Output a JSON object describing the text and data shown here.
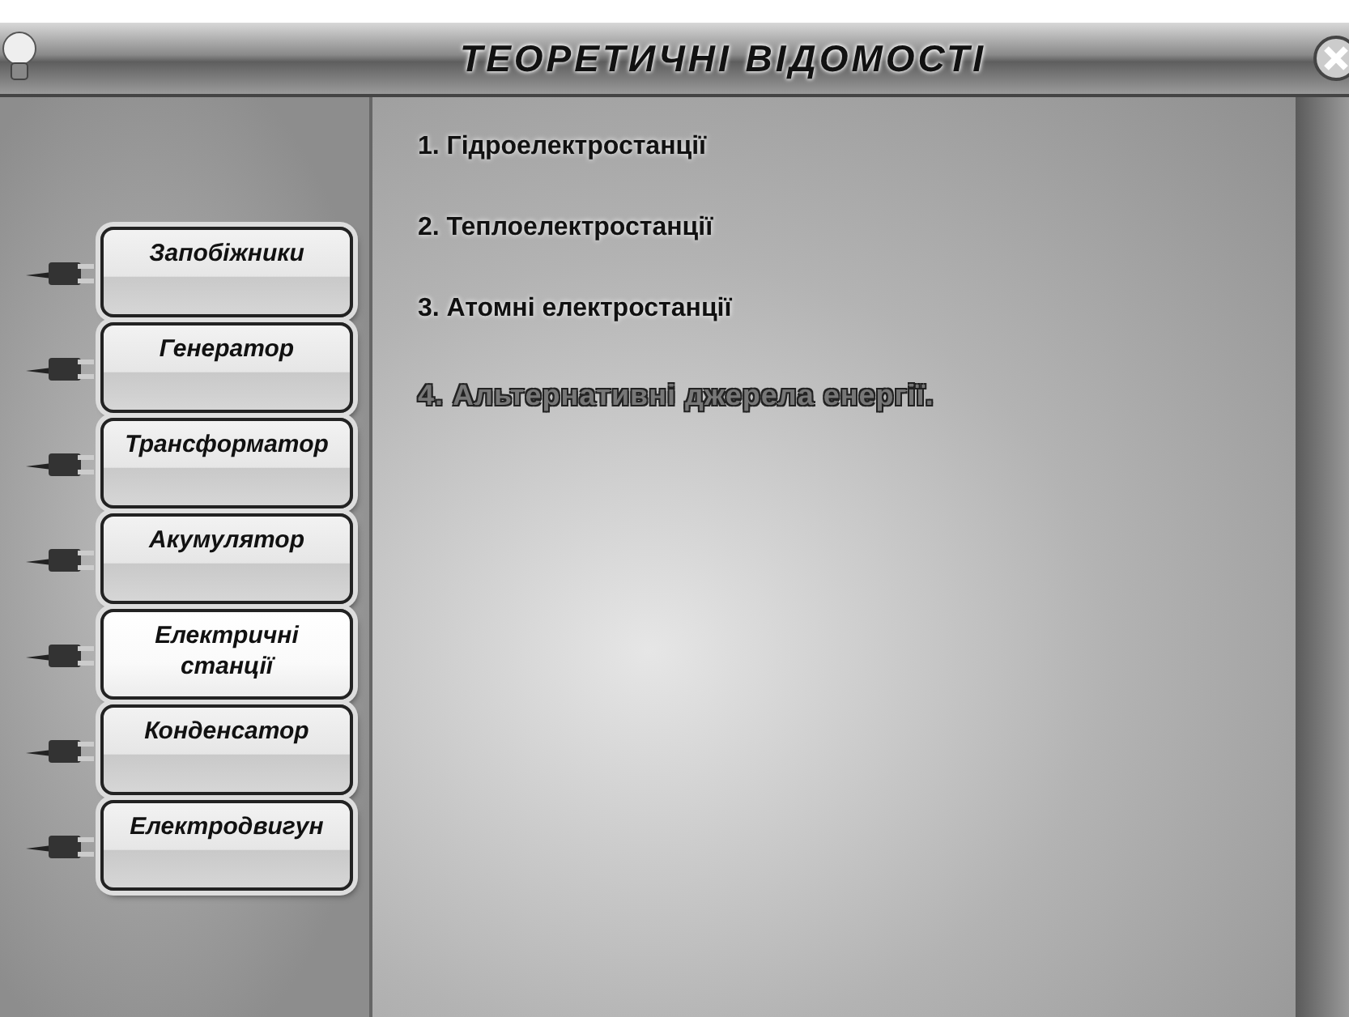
{
  "window": {
    "title": "ТЕОРЕТИЧНІ ВІДОМОСТІ"
  },
  "menu": [
    {
      "label": "Запобіжники",
      "selected": false
    },
    {
      "label": "Генератор",
      "selected": false
    },
    {
      "label": "Трансформатор",
      "selected": false
    },
    {
      "label": "Акумулятор",
      "selected": false
    },
    {
      "label": "Електричні станції",
      "selected": true
    },
    {
      "label": "Конденсатор",
      "selected": false
    },
    {
      "label": "Електродвигун",
      "selected": false
    }
  ],
  "topics": [
    {
      "label": "1. Гідроелектростанції",
      "selected": false
    },
    {
      "label": "2. Теплоелектростанції",
      "selected": false
    },
    {
      "label": "3. Атомні електростанції",
      "selected": false
    },
    {
      "label": "4. Альтернативні джерела енергії.",
      "selected": true
    }
  ]
}
